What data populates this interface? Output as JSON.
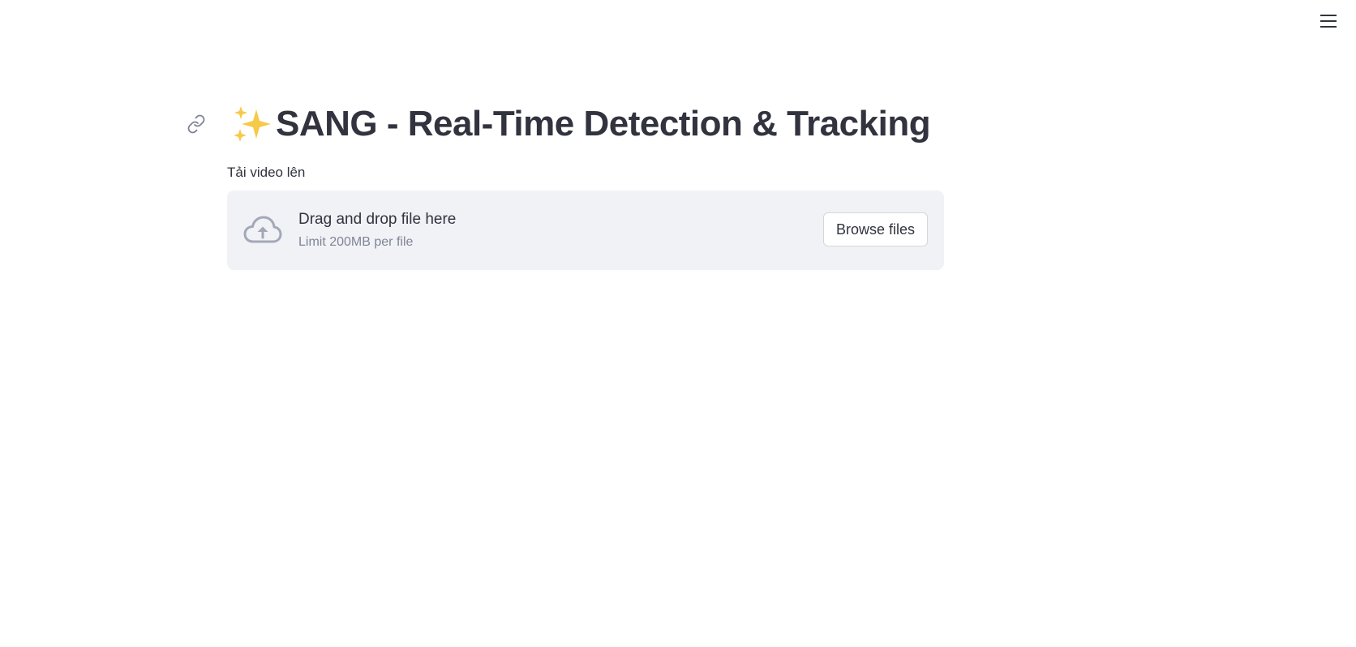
{
  "header": {
    "menu_icon": "hamburger-menu-icon"
  },
  "main": {
    "title": {
      "emoji": "sparkles-icon",
      "text": "SANG - Real-Time Detection & Tracking",
      "anchor_icon": "link-icon"
    },
    "uploader": {
      "label": "Tải video lên",
      "drop_text": "Drag and drop file here",
      "limit_text": "Limit 200MB per file",
      "browse_label": "Browse files",
      "icon": "cloud-upload-icon"
    }
  },
  "colors": {
    "text": "#31333f",
    "muted": "#808495",
    "dropzone_bg": "#f0f2f6",
    "icon_gray": "#a3a8b8",
    "sparkle": "#f7c948"
  }
}
